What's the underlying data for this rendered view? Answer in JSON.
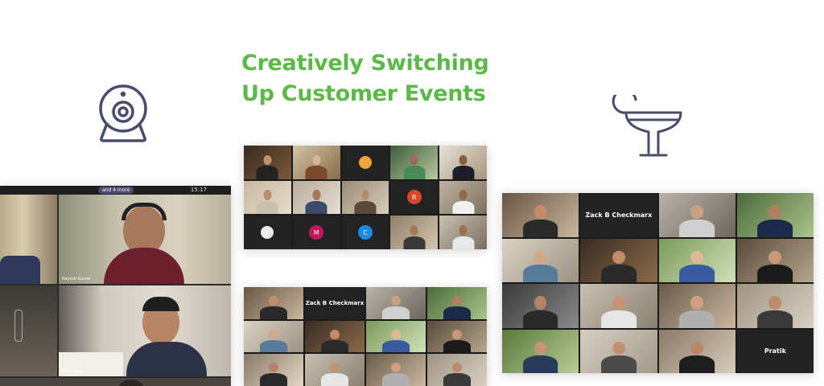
{
  "headline": {
    "line1": "Creatively Switching",
    "line2": "Up Customer Events"
  },
  "colors": {
    "accent": "#5cb947",
    "icon_stroke": "#4a4a6a"
  },
  "icons": {
    "left": "webcam-icon",
    "right": "cocktail-icon"
  },
  "left_call": {
    "participants_pill": "and 4 more",
    "clock": "15:17",
    "tile_labels": [
      "Rajnish Kumar",
      "Nitin Garg"
    ]
  },
  "middle_call_top": {
    "initials": [
      "R",
      "M",
      "C"
    ],
    "initial_colors": [
      "#d9472b",
      "#c2185b",
      "#1e88e5"
    ]
  },
  "middle_call_bottom": {
    "host_card": "Zack B Checkmarx"
  },
  "right_call": {
    "host_card": "Zack B Checkmarx",
    "pratik_card": "Pratik"
  }
}
